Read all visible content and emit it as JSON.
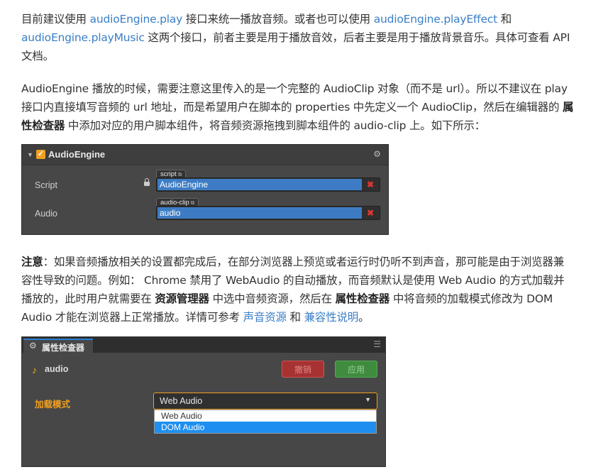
{
  "p1": {
    "t1": "目前建议使用 ",
    "link1": "audioEngine.play",
    "t2": " 接口来统一播放音频。或者也可以使用 ",
    "link2": "audioEngine.playEffect",
    "t3": " 和",
    "link3": "audioEngine.playMusic",
    "t4": " 这两个接口，前者主要是用于播放音效，后者主要是用于播放背景音乐。具体可查看 API 文档。"
  },
  "p2": {
    "t1": "AudioEngine 播放的时候，需要注意这里传入的是一个完整的 AudioClip 对象（而不是 url）。所以不建议在 play 接口内直接填写音频的 url 地址，而是希望用户在脚本的 properties 中先定义一个 AudioClip，然后在编辑器的 ",
    "b1": "属性检查器",
    "t2": " 中添加对应的用户脚本组件，将音频资源拖拽到脚本组件的 audio-clip 上。如下所示："
  },
  "panel1": {
    "title": "AudioEngine",
    "rows": [
      {
        "label": "Script",
        "tag": "script",
        "value": "AudioEngine"
      },
      {
        "label": "Audio",
        "tag": "audio-clip",
        "value": "audio"
      }
    ]
  },
  "p3": {
    "b1": "注意",
    "t1": "：如果音频播放相关的设置都完成后，在部分浏览器上预览或者运行时仍听不到声音，那可能是由于浏览器兼容性导致的问题。例如： Chrome 禁用了 WebAudio 的自动播放，而音频默认是使用 Web Audio 的方式加载并播放的，此时用户就需要在 ",
    "b2": "资源管理器",
    "t2": " 中选中音频资源，然后在 ",
    "b3": "属性检查器",
    "t3": " 中将音频的加载模式修改为 DOM Audio 才能在浏览器上正常播放。详情可参考 ",
    "link1": "声音资源",
    "t4": " 和 ",
    "link2": "兼容性说明",
    "t5": "。"
  },
  "panel2": {
    "tab": "属性检查器",
    "asset": "audio",
    "undo": "撤销",
    "apply": "应用",
    "load_label": "加载模式",
    "selected": "Web Audio",
    "options": [
      "Web Audio",
      "DOM Audio"
    ]
  }
}
